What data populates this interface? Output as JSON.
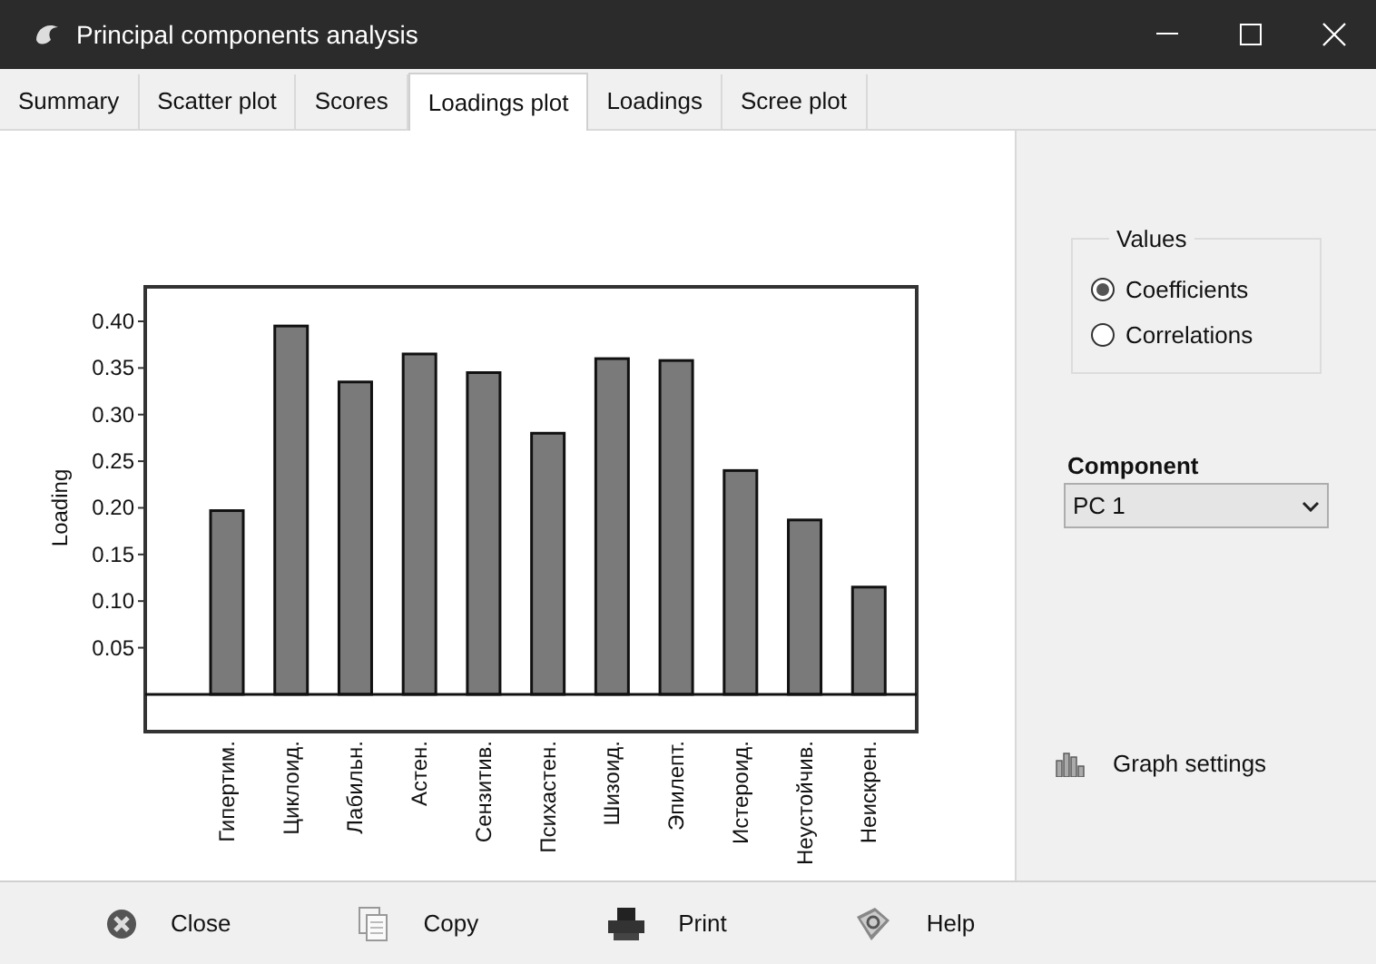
{
  "window": {
    "title": "Principal components analysis"
  },
  "tabs": [
    {
      "label": "Summary",
      "selected": false
    },
    {
      "label": "Scatter plot",
      "selected": false
    },
    {
      "label": "Scores",
      "selected": false
    },
    {
      "label": "Loadings plot",
      "selected": true
    },
    {
      "label": "Loadings",
      "selected": false
    },
    {
      "label": "Scree plot",
      "selected": false
    }
  ],
  "chart_data": {
    "type": "bar",
    "ylabel": "Loading",
    "categories": [
      "Гипертим.",
      "Циклоид.",
      "Лабильн.",
      "Астен.",
      "Сензитив.",
      "Психастен.",
      "Шизоид.",
      "Эпилепт.",
      "Истероид.",
      "Неустойчив.",
      "Неискрен."
    ],
    "values": [
      0.197,
      0.395,
      0.335,
      0.365,
      0.345,
      0.28,
      0.36,
      0.358,
      0.24,
      0.187,
      0.115
    ],
    "ylim": [
      -0.04,
      0.437
    ],
    "yticks": [
      {
        "value": 0.05,
        "label": "0.05"
      },
      {
        "value": 0.1,
        "label": "0.10"
      },
      {
        "value": 0.15,
        "label": "0.15"
      },
      {
        "value": 0.2,
        "label": "0.20"
      },
      {
        "value": 0.25,
        "label": "0.25"
      },
      {
        "value": 0.3,
        "label": "0.30"
      },
      {
        "value": 0.35,
        "label": "0.35"
      },
      {
        "value": 0.4,
        "label": "0.40"
      }
    ]
  },
  "values_group": {
    "title": "Values",
    "options": [
      {
        "label": "Coefficients",
        "selected": true
      },
      {
        "label": "Correlations",
        "selected": false
      }
    ]
  },
  "component": {
    "label": "Component",
    "value": "PC 1"
  },
  "graph_settings": {
    "label": "Graph settings"
  },
  "buttons": [
    {
      "kind": "close",
      "label": "Close"
    },
    {
      "kind": "copy",
      "label": "Copy"
    },
    {
      "kind": "print",
      "label": "Print"
    },
    {
      "kind": "help",
      "label": "Help"
    }
  ]
}
